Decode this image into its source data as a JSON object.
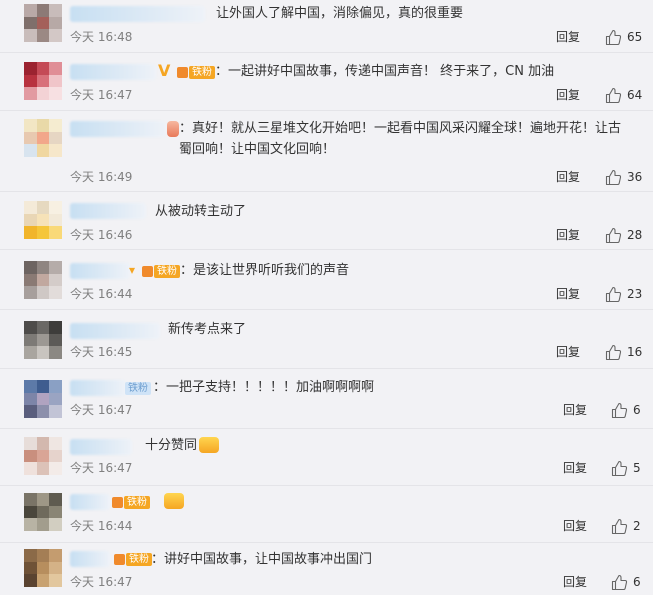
{
  "comments": [
    {
      "text": "让外国人了解中国，消除偏见，真的很重要",
      "time": "今天 16:48",
      "reply_label": "回复",
      "likes": "65",
      "badge": null
    },
    {
      "text": "：一起讲好中国故事，传递中国声音！ 终于来了，CN 加油",
      "time": "今天 16:47",
      "reply_label": "回复",
      "likes": "64",
      "badge": "铁粉"
    },
    {
      "text": "：真好！就从三星堆文化开始吧！一起看中国风采闪耀全球！遍地开花！让古\n蜀回响！让中国文化回响！",
      "time": "今天 16:49",
      "reply_label": "回复",
      "likes": "36",
      "badge": null
    },
    {
      "text": "从被动转主动了",
      "time": "今天 16:46",
      "reply_label": "回复",
      "likes": "28",
      "badge": null
    },
    {
      "text": "：是该让世界听听我们的声音",
      "time": "今天 16:44",
      "reply_label": "回复",
      "likes": "23",
      "badge": "铁粉"
    },
    {
      "text": "新传考点来了",
      "time": "今天 16:45",
      "reply_label": "回复",
      "likes": "16",
      "badge": null
    },
    {
      "text": "：一把子支持！！！！！加油啊啊啊啊",
      "time": "今天 16:47",
      "reply_label": "回复",
      "likes": "6",
      "badge": "铁粉"
    },
    {
      "text": "十分赞同",
      "time": "今天 16:47",
      "reply_label": "回复",
      "likes": "5",
      "badge": null
    },
    {
      "text": "",
      "time": "今天 16:44",
      "reply_label": "回复",
      "likes": "2",
      "badge": "铁粉"
    },
    {
      "text": "：讲好中国故事，让中国故事冲出国门",
      "time": "今天 16:47",
      "reply_label": "回复",
      "likes": "6",
      "badge": "铁粉"
    }
  ],
  "icons": {
    "like": "thumbs-up-icon",
    "badge": "fan-badge-icon",
    "emoji": "emoji-sticker-icon"
  },
  "colors": {
    "background": "#f2f2f5",
    "badge_orange": "#f5a623",
    "badge_blue_text": "#6f9fd0",
    "time_gray": "#808080",
    "text": "#333333"
  }
}
